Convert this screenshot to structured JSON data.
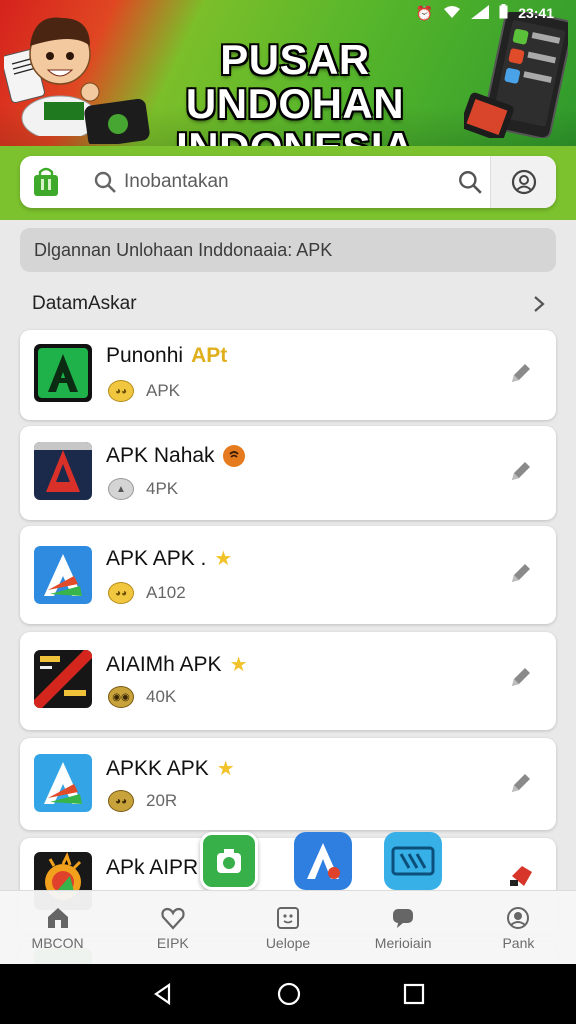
{
  "status_bar": {
    "time": "23:41"
  },
  "banner": {
    "title_line1": "PUSAR UNDOHAN",
    "title_line2": "INDONESIA"
  },
  "search": {
    "placeholder": "Inobantakan"
  },
  "notice": {
    "text": "Dlgannan Unlohaan Inddonaaia: APK"
  },
  "section": {
    "title": "DatamAskar"
  },
  "apps": [
    {
      "name": "Punonhi",
      "tag": "APt",
      "meta": "APK"
    },
    {
      "name": "APK Nahak",
      "meta": "4PK"
    },
    {
      "name": "APK APK .",
      "meta": "A102"
    },
    {
      "name": "AIAIMh APK",
      "meta": "40K"
    },
    {
      "name": "APKK APK",
      "meta": "20R"
    },
    {
      "name": "APk AIPR",
      "meta": ""
    }
  ],
  "bottom_nav": [
    {
      "label": "MBCON",
      "icon": "home-icon"
    },
    {
      "label": "EIPK",
      "icon": "heart-icon"
    },
    {
      "label": "Uelope",
      "icon": "face-icon"
    },
    {
      "label": "Merioiain",
      "icon": "chat-icon"
    },
    {
      "label": "Pank",
      "icon": "user-icon"
    }
  ],
  "colors": {
    "brand_green": "#7cc22e",
    "banner_red": "#d5221d",
    "star_yellow": "#f2c22a"
  }
}
